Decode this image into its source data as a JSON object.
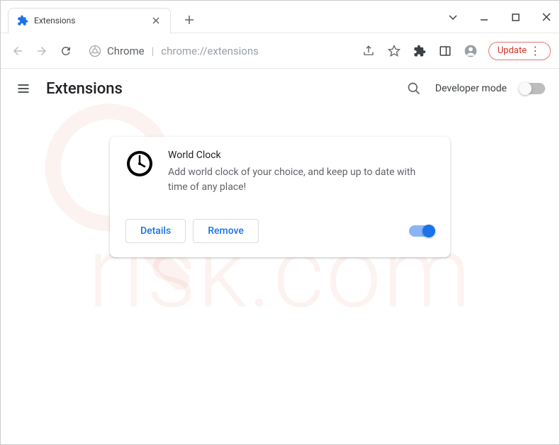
{
  "window": {
    "tab_title": "Extensions",
    "address_host": "Chrome",
    "address_path": "chrome://extensions",
    "update_label": "Update"
  },
  "page": {
    "title": "Extensions",
    "developer_mode_label": "Developer mode"
  },
  "extension": {
    "name": "World Clock",
    "description": "Add world clock of your choice, and keep up to date with time of any place!",
    "details_label": "Details",
    "remove_label": "Remove",
    "enabled": true
  }
}
